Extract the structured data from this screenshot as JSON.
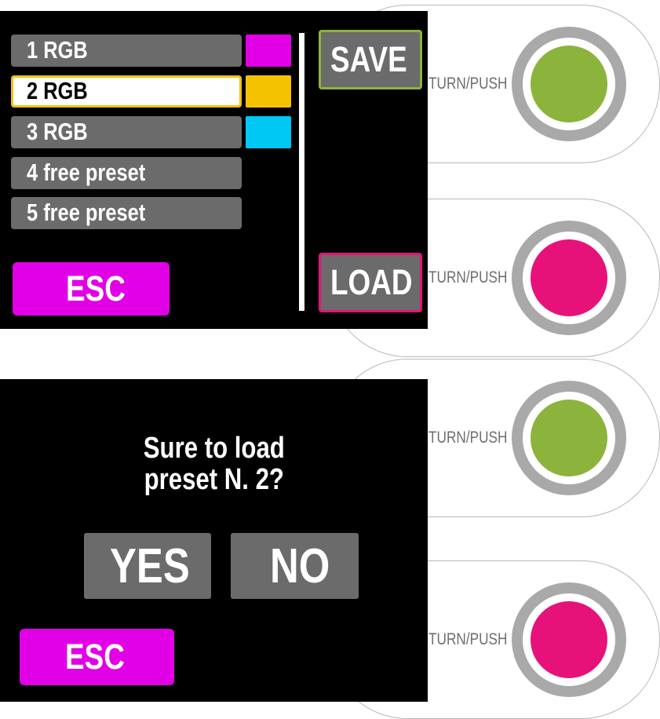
{
  "colors": {
    "magenta": "#e100e6",
    "yellow": "#f5c200",
    "cyan": "#00c8f5",
    "green": "#8cb43c",
    "pink": "#e6127a",
    "button_gray": "#6b6b6b"
  },
  "preset_screen": {
    "presets": [
      {
        "label": "1 RGB",
        "swatch": "#e100e6"
      },
      {
        "label": "2 RGB",
        "swatch": "#f5c200",
        "selected": true
      },
      {
        "label": "3 RGB",
        "swatch": "#00c8f5"
      },
      {
        "label": "4 free preset"
      },
      {
        "label": "5 free preset"
      }
    ],
    "save_label": "SAVE",
    "load_label": "LOAD",
    "esc_label": "ESC"
  },
  "confirm_screen": {
    "question_line1": "Sure to load",
    "question_line2": "preset N. 2?",
    "yes_label": "YES",
    "no_label": "NO",
    "esc_label": "ESC"
  },
  "knobs": [
    {
      "label": "TURN/PUSH",
      "color": "#8cb43c"
    },
    {
      "label": "TURN/PUSH",
      "color": "#e6127a"
    },
    {
      "label": "TURN/PUSH",
      "color": "#8cb43c"
    },
    {
      "label": "TURN/PUSH",
      "color": "#e6127a"
    }
  ]
}
